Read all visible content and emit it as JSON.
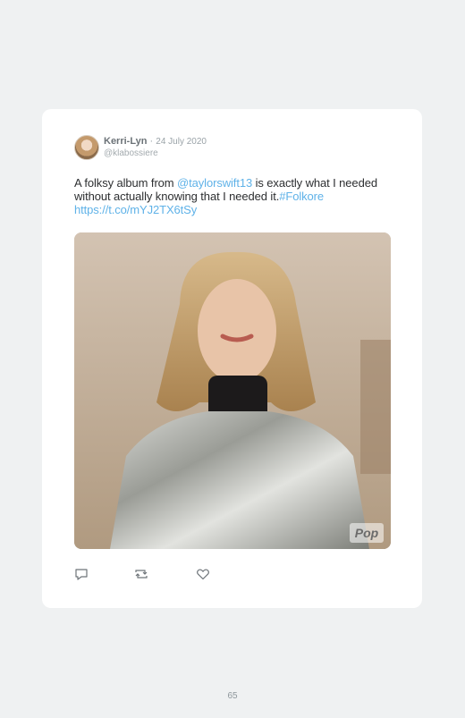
{
  "tweet": {
    "author_name": "Kerri-Lyn",
    "separator": " · ",
    "date": "24 July 2020",
    "handle": "@klabossiere",
    "text_part1": "A folksy album from ",
    "mention": "@taylorswift13",
    "text_part2": " is exactly what I needed without actually knowing that I needed it.",
    "hashtag": "#Folkore",
    "url": "https://t.co/mYJ2TX6tSy",
    "media_watermark": "Pop"
  },
  "actions": {
    "reply_icon": "reply-icon",
    "retweet_icon": "retweet-icon",
    "like_icon": "heart-icon"
  },
  "page": {
    "number": "65"
  },
  "colors": {
    "background": "#eff1f2",
    "card": "#ffffff",
    "link": "#5fb2e8",
    "text": "#2d2f31",
    "muted": "#9aa3a8"
  }
}
